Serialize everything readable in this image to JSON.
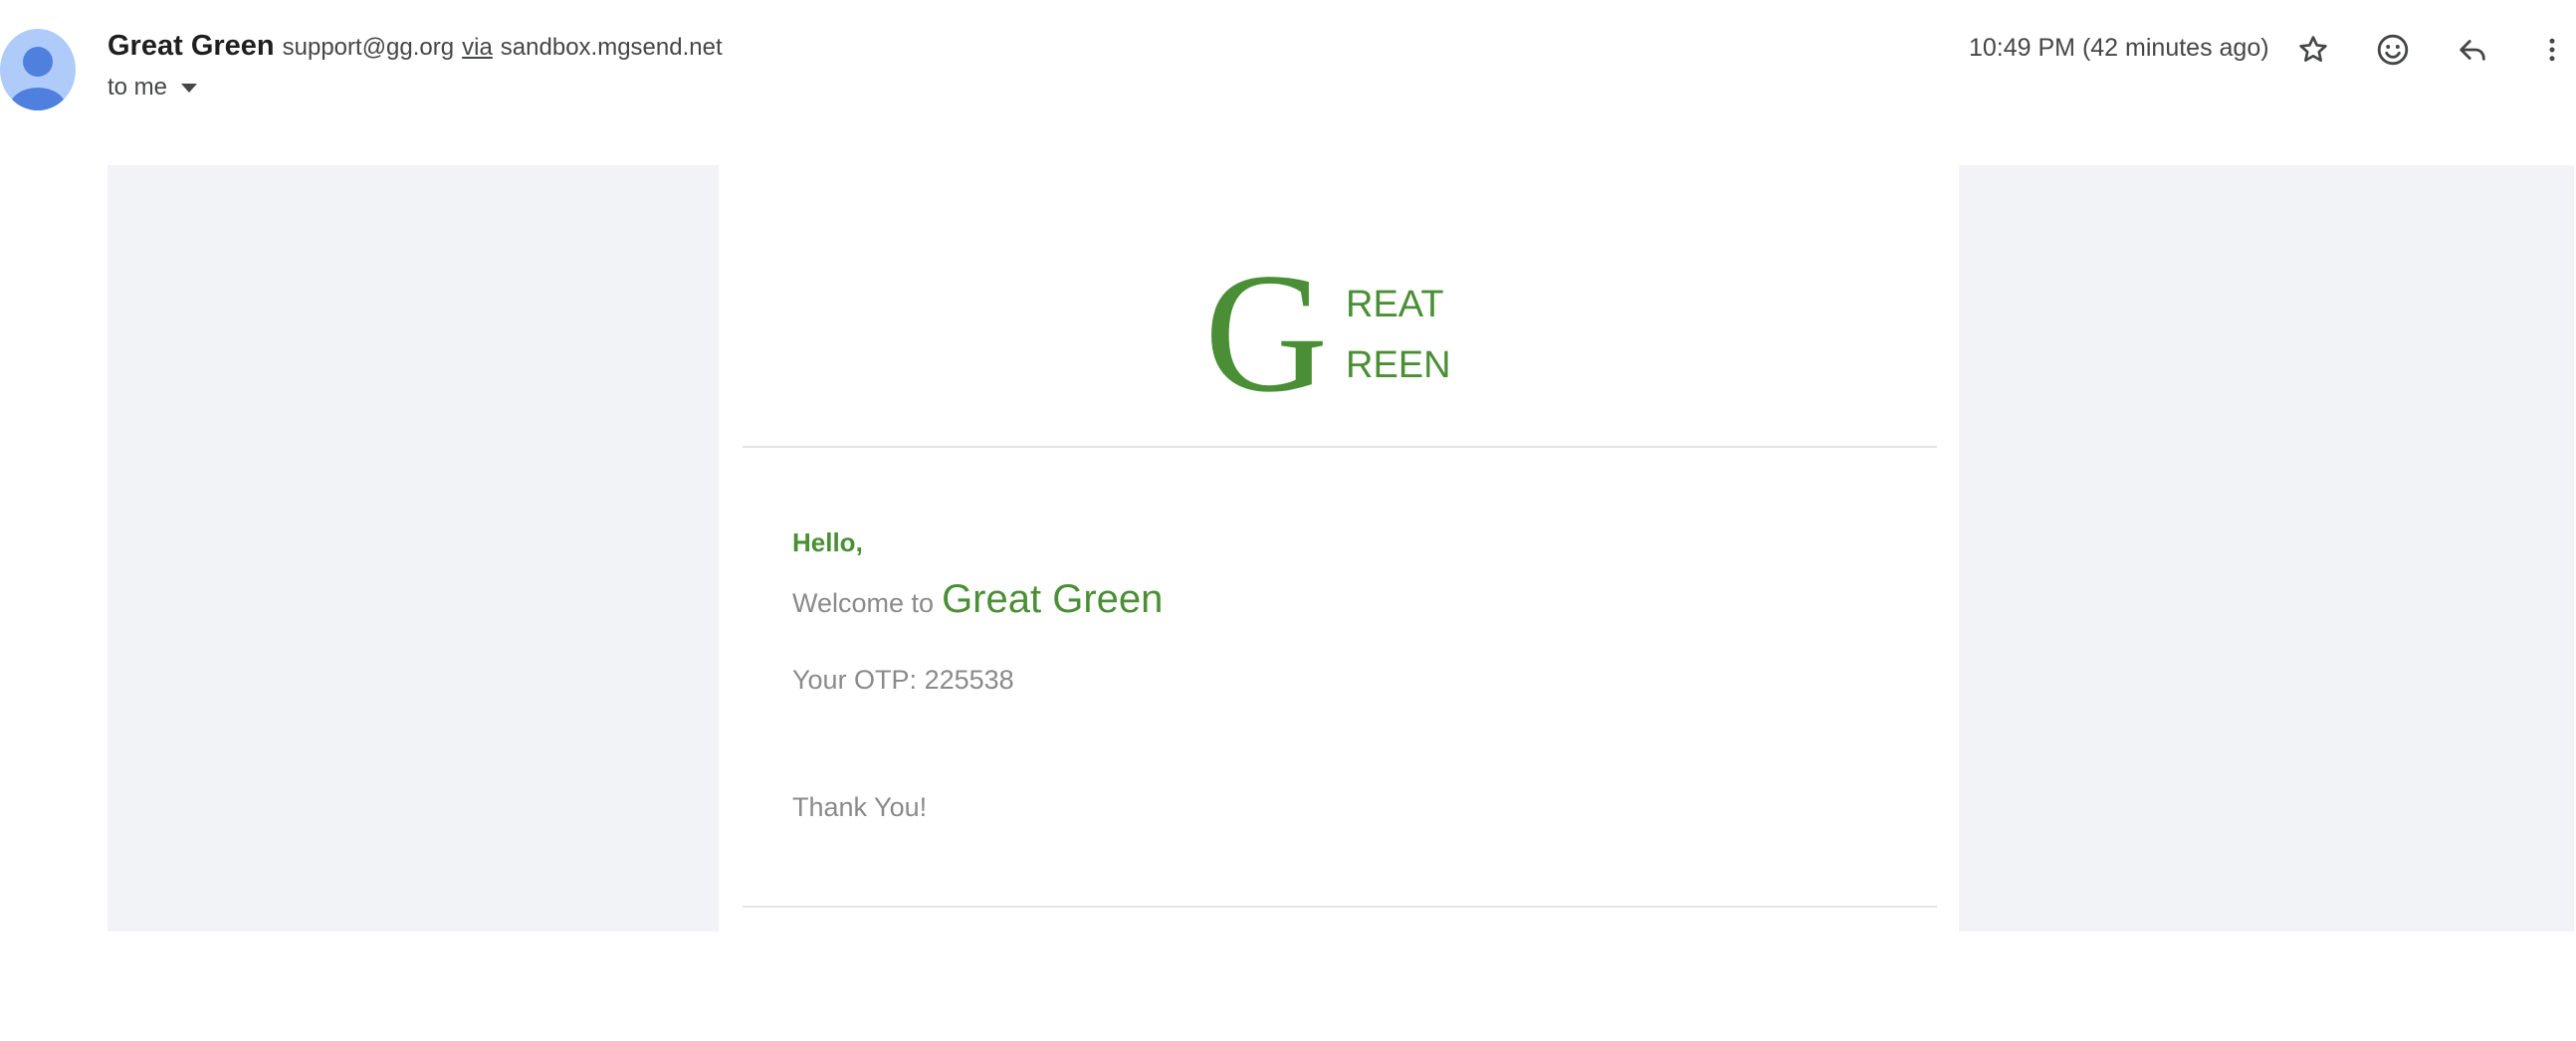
{
  "header": {
    "sender_name": "Great Green",
    "sender_email": "support@gg.org",
    "via_label": "via",
    "via_domain": "sandbox.mgsend.net",
    "recipient_label": "to me",
    "timestamp": "10:49 PM (42 minutes ago)",
    "icons": [
      "person-avatar-icon",
      "star-icon",
      "emoji-icon",
      "reply-icon",
      "more-vert-icon"
    ]
  },
  "email": {
    "logo_text": {
      "initial": "G",
      "line1": "REAT",
      "line2": "REEN"
    },
    "greeting": "Hello,",
    "welcome_prefix": "Welcome to",
    "welcome_brand": "Great Green",
    "otp_label": "Your OTP:",
    "otp_value": "225538",
    "closing": "Thank You!"
  },
  "colors": {
    "brand_green": "#4a8f35",
    "body_gray_text": "#8a8a8a",
    "side_panel_bg": "#f2f3f6",
    "avatar_bg": "#aecbfa",
    "avatar_fg": "#4f80de"
  }
}
